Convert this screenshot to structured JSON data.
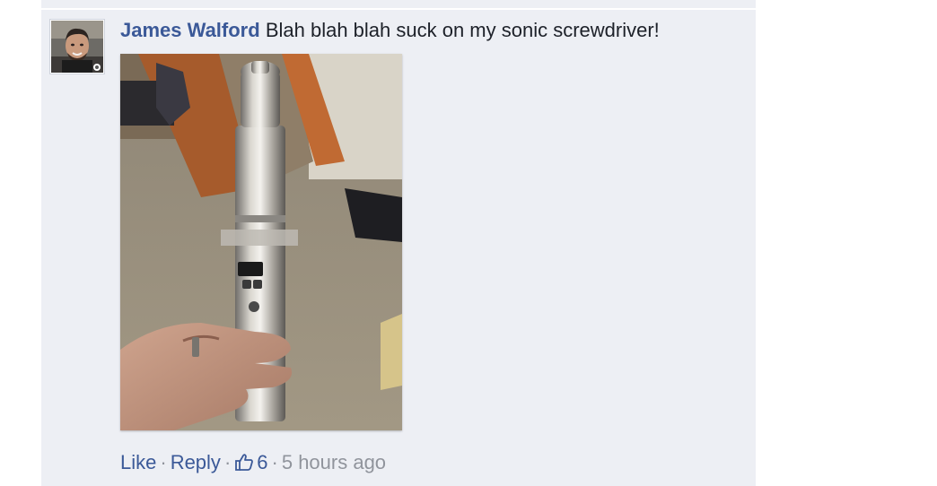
{
  "comment": {
    "author": "James Walford",
    "text": "Blah blah blah suck on my sonic screwdriver!",
    "photo_description": "",
    "actions": {
      "like_label": "Like",
      "reply_label": "Reply",
      "separator": "·",
      "like_count": "6",
      "timestamp": "5 hours ago"
    },
    "icons": {
      "like": "thumbs-up-icon"
    }
  },
  "colors": {
    "link": "#3b5998",
    "text": "#1d2129",
    "muted": "#90949c",
    "panel_background": "#edeff4"
  }
}
